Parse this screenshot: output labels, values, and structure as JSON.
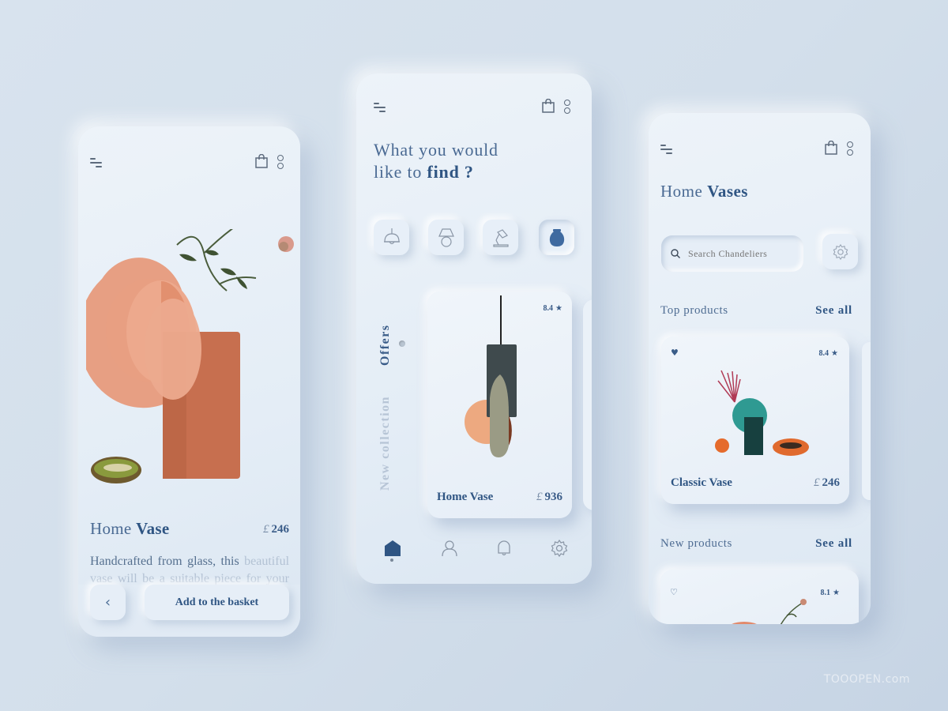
{
  "colors": {
    "background": "#d6e1ec",
    "accent": "#2f5583",
    "muted": "#b7c5d6"
  },
  "phone_detail": {
    "product_title_light": "Home",
    "product_title_bold": "Vase",
    "currency": "£",
    "price": "246",
    "description_visible": "Handcrafted from glass, this",
    "description_faded": "beautiful vase will be a suitable piece for your home.",
    "back_icon": "chevron-left-icon",
    "back_glyph": "‹",
    "add_to_basket_label": "Add to the basket"
  },
  "phone_browse": {
    "heading_line1": "What you would",
    "heading_line2_light": "like to",
    "heading_line2_bold": "find ?",
    "categories": [
      {
        "name": "pendant-lamp",
        "icon": "pendant-lamp-icon",
        "active": false
      },
      {
        "name": "table-lamp",
        "icon": "table-lamp-icon",
        "active": false
      },
      {
        "name": "desk-lamp",
        "icon": "desk-lamp-icon",
        "active": false
      },
      {
        "name": "vase",
        "icon": "vase-icon",
        "active": true
      }
    ],
    "vertical_tabs": [
      {
        "label": "Offers",
        "active": true
      },
      {
        "label": "New collection",
        "active": false
      }
    ],
    "offer_card": {
      "rating": "8.4",
      "name": "Home Vase",
      "currency": "£",
      "price": "936"
    },
    "bottom_nav": [
      {
        "name": "home",
        "icon": "home-icon",
        "active": true
      },
      {
        "name": "profile",
        "icon": "user-icon",
        "active": false
      },
      {
        "name": "notifications",
        "icon": "bell-icon",
        "active": false
      },
      {
        "name": "settings",
        "icon": "gear-icon",
        "active": false
      }
    ]
  },
  "phone_list": {
    "title_light": "Home",
    "title_bold": "Vases",
    "search_placeholder": "Search Chandeliers",
    "top_products_label": "Top  products",
    "top_see_all": "See all",
    "top_card": {
      "favorited": true,
      "rating": "8.4",
      "name": "Classic Vase",
      "currency": "£",
      "price": "246"
    },
    "new_products_label": "New products",
    "new_see_all": "See all",
    "new_card": {
      "favorited": false,
      "rating": "8.1"
    }
  },
  "watermark": "TOOOPEN.com"
}
